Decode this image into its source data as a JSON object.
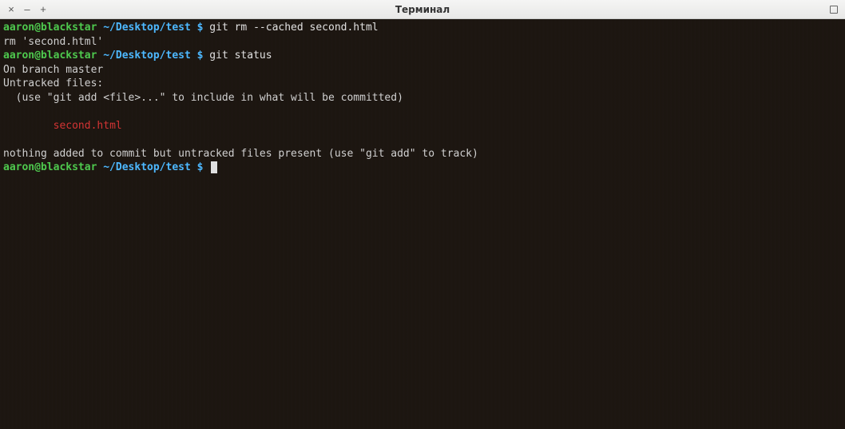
{
  "window": {
    "title": "Терминал"
  },
  "terminal": {
    "prompt": {
      "userhost": "aaron@blackstar",
      "path": "~/Desktop/test",
      "symbol": "$"
    },
    "lines": {
      "cmd1": "git rm --cached second.html",
      "out1": "rm 'second.html'",
      "cmd2": "git status",
      "out2": "On branch master",
      "out3": "Untracked files:",
      "out4": "  (use \"git add <file>...\" to include in what will be committed)",
      "out5_indent": "        ",
      "out5_file": "second.html",
      "out6": "nothing added to commit but untracked files present (use \"git add\" to track)"
    }
  }
}
